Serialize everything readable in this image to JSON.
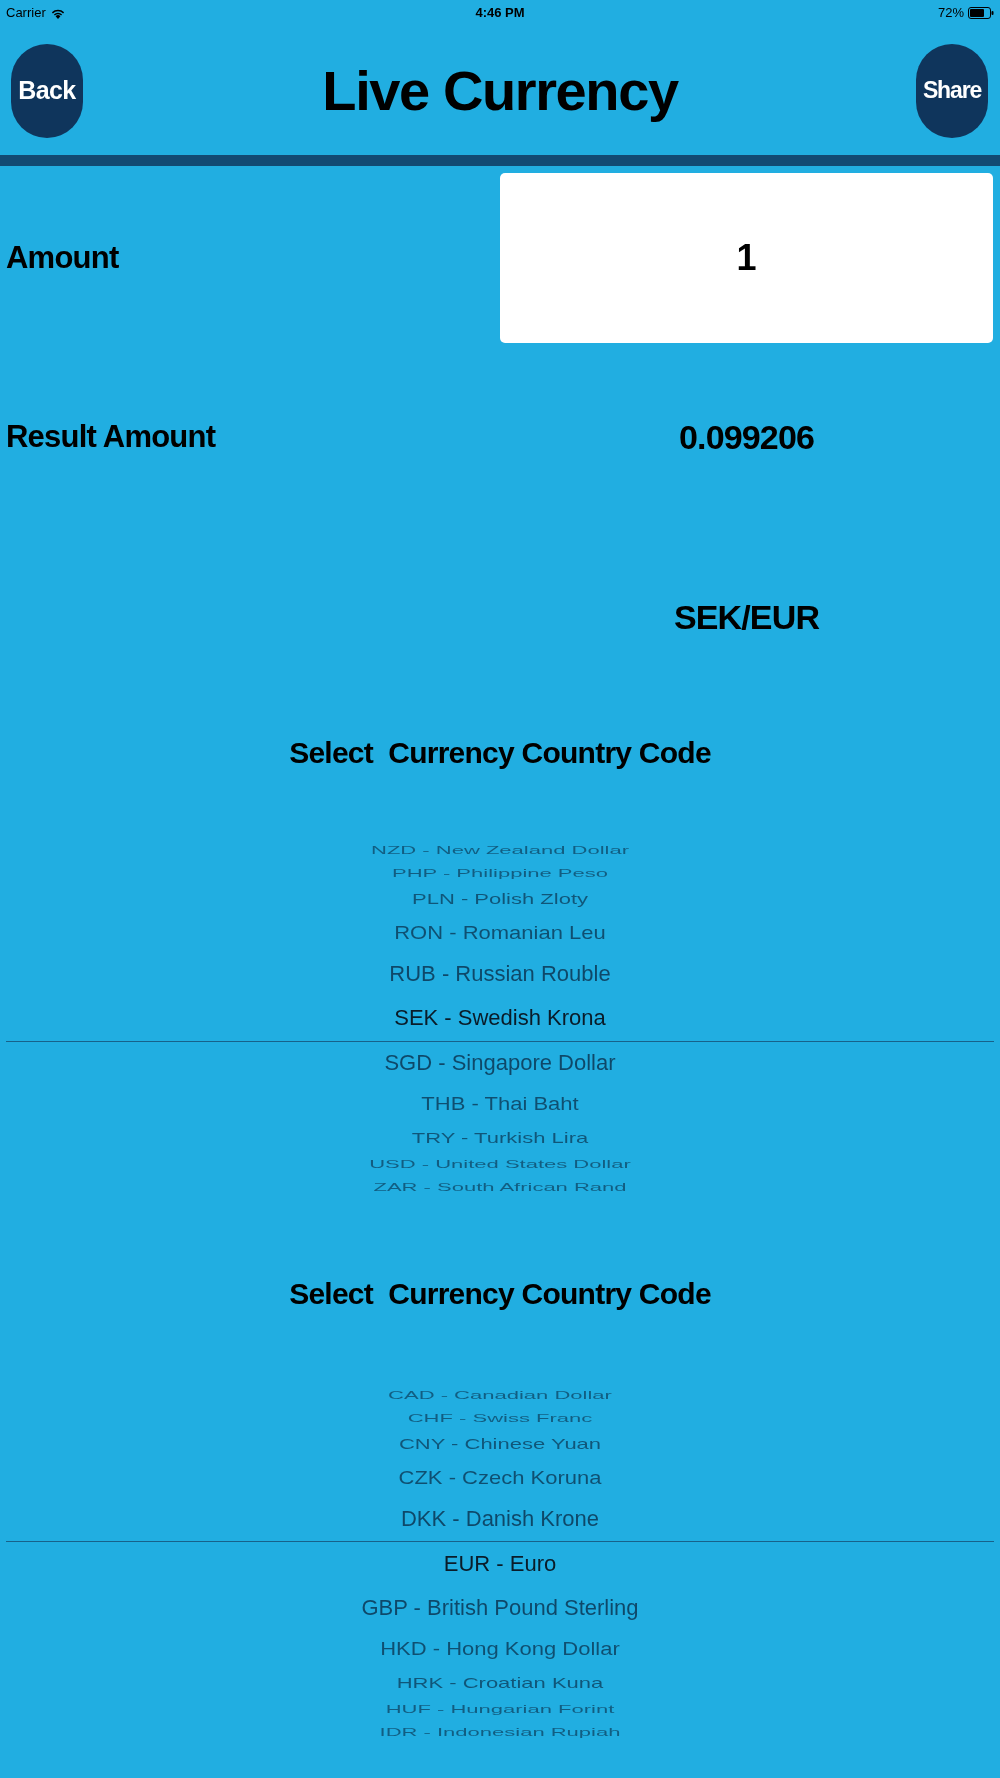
{
  "status_bar": {
    "carrier": "Carrier",
    "time": "4:46 PM",
    "battery": "72%"
  },
  "header": {
    "back_button": "Back",
    "title": "Live Currency",
    "share_button": "Share"
  },
  "amount": {
    "label": "Amount",
    "value": "1"
  },
  "result": {
    "label": "Result Amount",
    "value": "0.099206"
  },
  "pair": "SEK/EUR",
  "pickers": [
    {
      "title": "Select  Currency Country Code",
      "line_above": false,
      "line_below": true,
      "items": [
        {
          "label": "NZD - New Zealand Dollar",
          "selected": false
        },
        {
          "label": "PHP - Philippine Peso",
          "selected": false
        },
        {
          "label": "PLN - Polish Zloty",
          "selected": false
        },
        {
          "label": "RON - Romanian Leu",
          "selected": false
        },
        {
          "label": "RUB - Russian Rouble",
          "selected": false
        },
        {
          "label": "SEK - Swedish Krona",
          "selected": true
        },
        {
          "label": "SGD - Singapore Dollar",
          "selected": false
        },
        {
          "label": "THB - Thai Baht",
          "selected": false
        },
        {
          "label": "TRY - Turkish Lira",
          "selected": false
        },
        {
          "label": "USD - United States Dollar",
          "selected": false
        },
        {
          "label": "ZAR - South African Rand",
          "selected": false
        }
      ]
    },
    {
      "title": "Select  Currency Country Code",
      "line_above": true,
      "line_below": false,
      "items": [
        {
          "label": "CAD - Canadian Dollar",
          "selected": false
        },
        {
          "label": "CHF - Swiss Franc",
          "selected": false
        },
        {
          "label": "CNY - Chinese Yuan",
          "selected": false
        },
        {
          "label": "CZK - Czech Koruna",
          "selected": false
        },
        {
          "label": "DKK - Danish Krone",
          "selected": false
        },
        {
          "label": "EUR - Euro",
          "selected": true
        },
        {
          "label": "GBP - British Pound Sterling",
          "selected": false
        },
        {
          "label": "HKD - Hong Kong Dollar",
          "selected": false
        },
        {
          "label": "HRK - Croatian Kuna",
          "selected": false
        },
        {
          "label": "HUF - Hungarian Forint",
          "selected": false
        },
        {
          "label": "IDR - Indonesian Rupiah",
          "selected": false
        }
      ]
    }
  ]
}
